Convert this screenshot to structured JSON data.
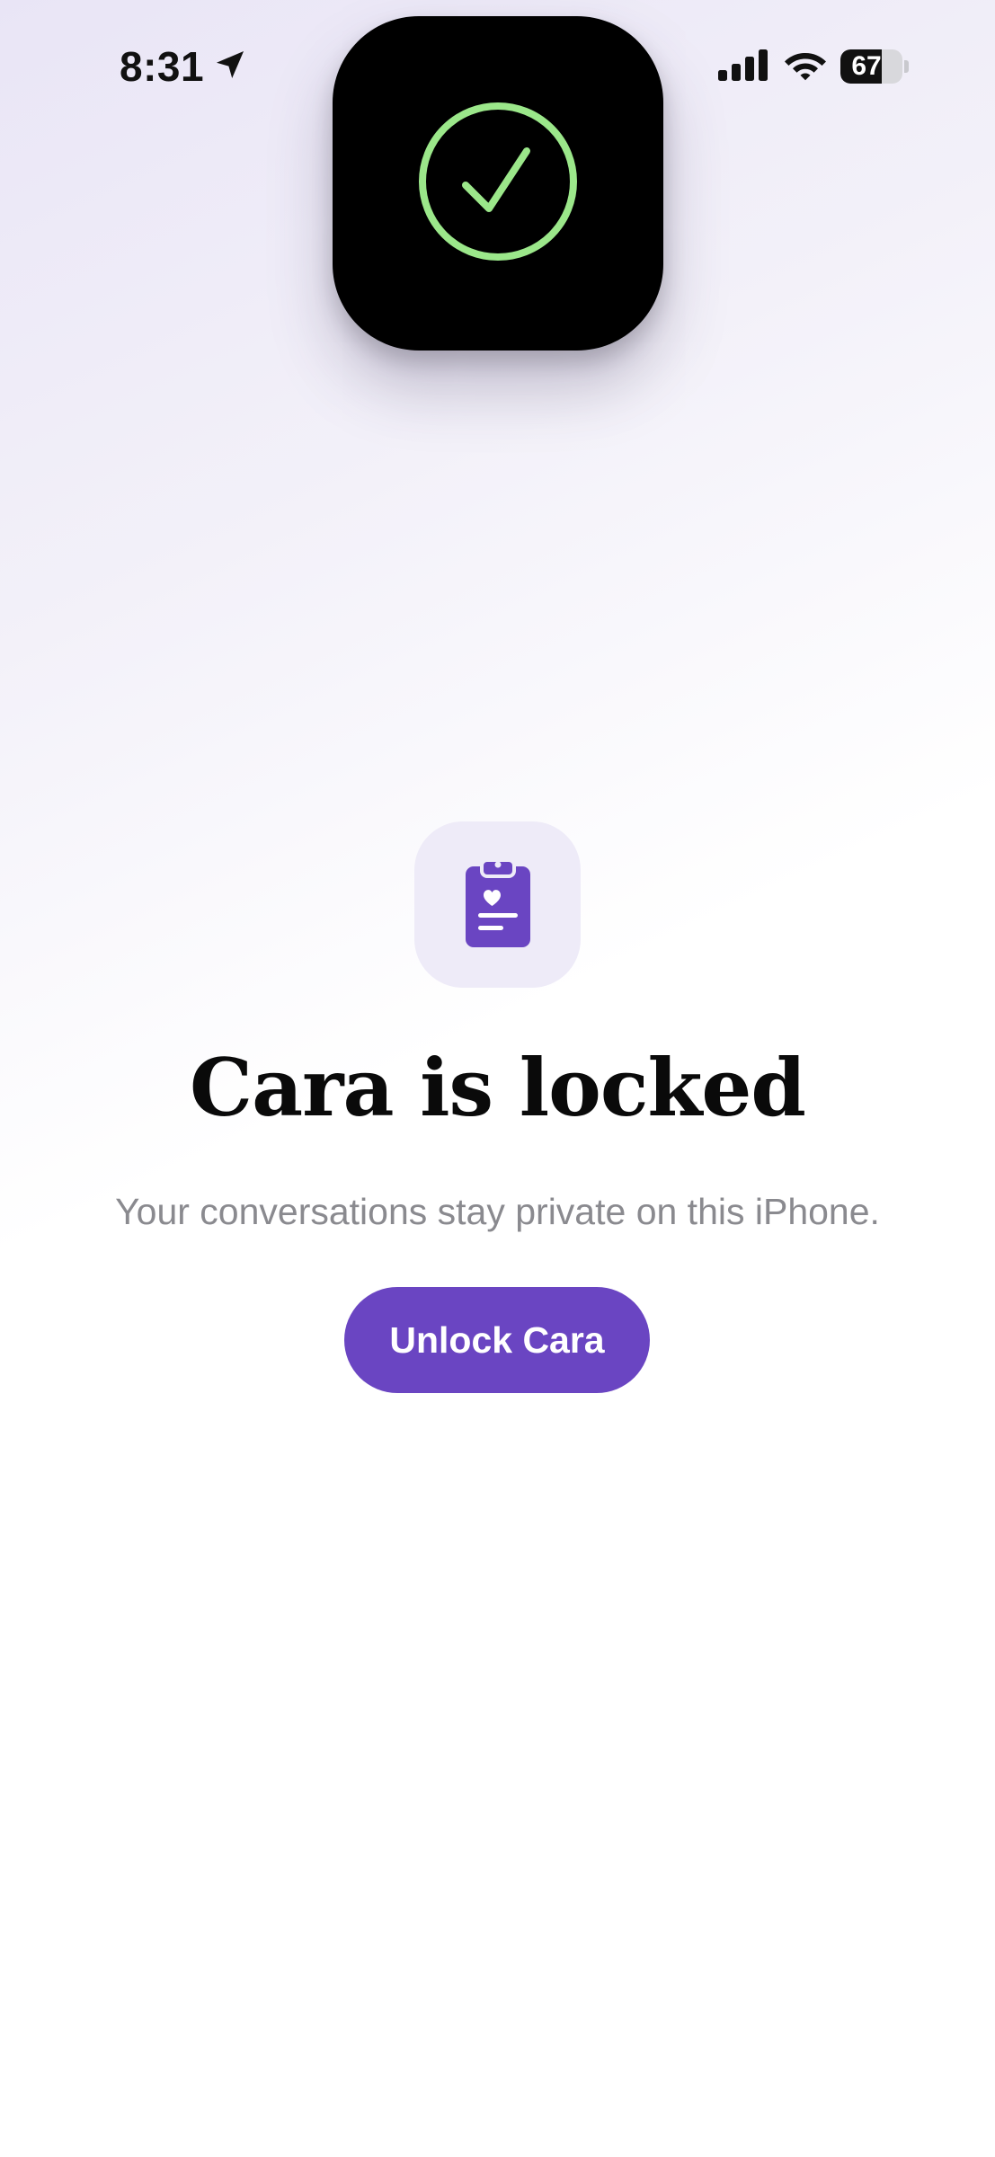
{
  "status_bar": {
    "time": "8:31",
    "location_icon": "location-arrow-icon",
    "signal_icon": "cellular-signal-icon",
    "wifi_icon": "wifi-icon",
    "battery_icon": "battery-icon",
    "battery_percent": "67",
    "battery_level": 0.67
  },
  "overlay": {
    "app_icon": "checkmark-circle-icon",
    "check_color": "#9be78a",
    "tile_color": "#000000"
  },
  "lock_screen": {
    "icon": "clipboard-heart-icon",
    "accent_color": "#6a45c2",
    "title": "Cara is locked",
    "subtitle": "Your conversations stay private on this iPhone.",
    "unlock_label": "Unlock Cara"
  }
}
